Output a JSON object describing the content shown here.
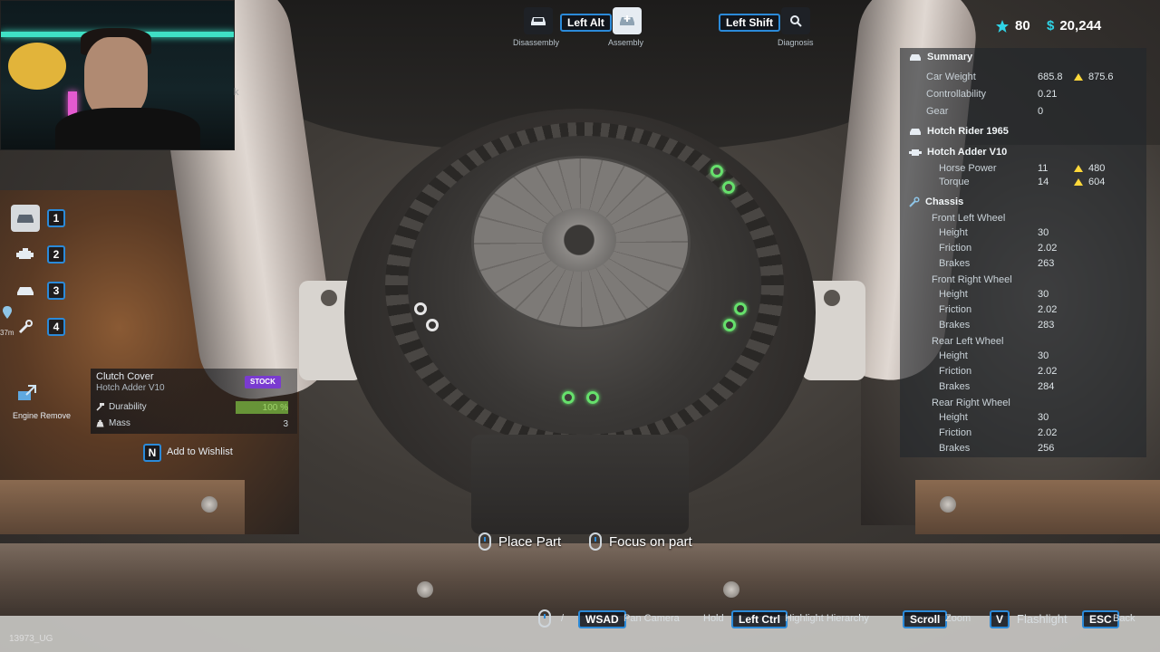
{
  "topbar": {
    "disassembly_label": "Disassembly",
    "left_alt_key": "Left Alt",
    "assembly_label": "Assembly",
    "left_shift_key": "Left Shift",
    "diagnosis_label": "Diagnosis"
  },
  "stats": {
    "stars": "80",
    "money": "20,244"
  },
  "left_tabs": [
    {
      "icon": "car-icon",
      "key": "1"
    },
    {
      "icon": "engine-icon",
      "key": "2"
    },
    {
      "icon": "car-body-icon",
      "key": "3"
    },
    {
      "icon": "wrench-icon",
      "key": "4"
    }
  ],
  "left_misc": {
    "distance": "37m",
    "engine_remove": "Engine Remove",
    "partial_text": "k"
  },
  "part_card": {
    "name": "Clutch Cover",
    "subtitle": "Hotch Adder V10",
    "badge": "STOCK",
    "durability_label": "Durability",
    "durability_value": "100 %",
    "durability_fraction": 1.0,
    "mass_label": "Mass",
    "mass_value": "3"
  },
  "wishlist": {
    "key": "N",
    "label": "Add to Wishlist"
  },
  "summary": {
    "title": "Summary",
    "car_weight_label": "Car Weight",
    "car_weight": "685.8",
    "car_weight_max": "875.6",
    "controllability_label": "Controllability",
    "controllability": "0.21",
    "gear_label": "Gear",
    "gear": "0",
    "car_name": "Hotch Rider 1965",
    "engine_name": "Hotch Adder V10",
    "horse_power_label": "Horse Power",
    "horse_power": "11",
    "horse_power_max": "480",
    "torque_label": "Torque",
    "torque": "14",
    "torque_max": "604",
    "chassis_title": "Chassis",
    "wheels": [
      {
        "name": "Front Left Wheel",
        "height_label": "Height",
        "height": "30",
        "friction_label": "Friction",
        "friction": "2.02",
        "brakes_label": "Brakes",
        "brakes": "263"
      },
      {
        "name": "Front Right Wheel",
        "height_label": "Height",
        "height": "30",
        "friction_label": "Friction",
        "friction": "2.02",
        "brakes_label": "Brakes",
        "brakes": "283"
      },
      {
        "name": "Rear Left Wheel",
        "height_label": "Height",
        "height": "30",
        "friction_label": "Friction",
        "friction": "2.02",
        "brakes_label": "Brakes",
        "brakes": "284"
      },
      {
        "name": "Rear Right Wheel",
        "height_label": "Height",
        "height": "30",
        "friction_label": "Friction",
        "friction": "2.02",
        "brakes_label": "Brakes",
        "brakes": "256"
      }
    ]
  },
  "prompts": {
    "place_part": "Place Part",
    "focus_on_part": "Focus on part"
  },
  "bottom_hints": {
    "separator": "/",
    "wsad_key": "WSAD",
    "pan_camera": "Pan Camera",
    "hold": "Hold",
    "left_ctrl_key": "Left Ctrl",
    "highlight_hierarchy": "Highlight Hierarchy",
    "scroll_key": "Scroll",
    "zoom": "Zoom",
    "v_key": "V",
    "flashlight": "Flashlight",
    "esc_key": "ESC",
    "back": "Back"
  },
  "bottom_left_text": "13973_UG",
  "colors": {
    "key_border": "#2b8ad9",
    "highlight_green": "#66e06c",
    "stock_badge": "#7a3bd0",
    "arrow_yellow": "#ffd83a",
    "star": "#2fd3e6",
    "money": "#2fd3e6"
  }
}
